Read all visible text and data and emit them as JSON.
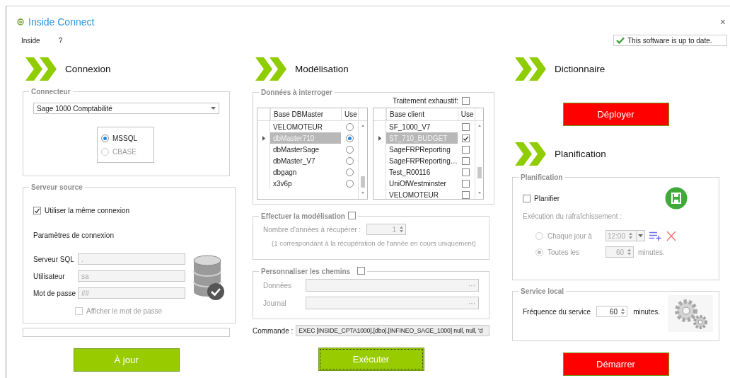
{
  "window": {
    "title": "Inside Connect",
    "close": "×"
  },
  "menu": [
    {
      "label": "Inside"
    },
    {
      "label": "?"
    }
  ],
  "update_status": "This software is up to date.",
  "connexion": {
    "title": "Connexion",
    "connecteur": {
      "legend": "Connecteur",
      "value": "Sage 1000 Comptabilité",
      "options": [
        {
          "label": "MSSQL",
          "selected": true,
          "disabled": false
        },
        {
          "label": "CBASE",
          "selected": false,
          "disabled": true
        }
      ]
    },
    "serveur_source": {
      "legend": "Serveur source",
      "same_connection": {
        "label": "Utiliser la même connexion",
        "checked": true
      },
      "params_label": "Paramètres de connexion",
      "fields": [
        {
          "label": "Serveur SQL",
          "value": "."
        },
        {
          "label": "Utilisateur",
          "value": "sa"
        },
        {
          "label": "Mot de passe",
          "value": "##"
        }
      ],
      "show_password": {
        "label": "Afficher le mot de passe",
        "checked": false
      }
    },
    "button": "À jour"
  },
  "modelisation": {
    "title": "Modélisation",
    "donnees": {
      "legend": "Données à interroger",
      "exhaustive": {
        "label": "Traitement exhaustif:",
        "checked": false
      },
      "tables": [
        {
          "kind": "radio",
          "columns": [
            "Base DBMaster",
            "Use"
          ],
          "rows": [
            {
              "name": "VELOMOTEUR",
              "selected": false,
              "use": false
            },
            {
              "name": "dbMaster710",
              "selected": true,
              "use": true
            },
            {
              "name": "dbMasterSage",
              "selected": false,
              "use": false
            },
            {
              "name": "dbMaster_V7",
              "selected": false,
              "use": false
            },
            {
              "name": "dbgagn",
              "selected": false,
              "use": false
            },
            {
              "name": "x3v6p",
              "selected": false,
              "use": false
            }
          ]
        },
        {
          "kind": "checkbox",
          "columns": [
            "Base client",
            "Use"
          ],
          "rows": [
            {
              "name": "SF_1000_V7",
              "selected": false,
              "use": false
            },
            {
              "name": "ST_710_BUDGET",
              "selected": true,
              "use": true
            },
            {
              "name": "SageFRPReporting",
              "selected": false,
              "use": false
            },
            {
              "name": "SageFRPReporting…",
              "selected": false,
              "use": false
            },
            {
              "name": "Test_R00116",
              "selected": false,
              "use": false
            },
            {
              "name": "UniOfWestminster",
              "selected": false,
              "use": false
            },
            {
              "name": "VELOMOTEUR",
              "selected": false,
              "use": false
            }
          ]
        }
      ]
    },
    "effectuer": {
      "legend": "Effectuer la modélisation",
      "checked": false,
      "years_label": "Nombre d'années à récupérer :",
      "years": "1",
      "note": "(1 correspondant à la récupération de l'année en cours uniquement)"
    },
    "chemins": {
      "legend": "Personnaliser les chemins",
      "checked": false,
      "fields": [
        {
          "label": "Données",
          "browse": "···"
        },
        {
          "label": "Journal",
          "browse": "···"
        }
      ]
    },
    "commande": {
      "label": "Commande :",
      "value": "EXEC [INSIDE_CPTA1000].[dbo].[INFINEO_SAGE_1000] null, null, 'd"
    },
    "button": {
      "label": "Exécuter",
      "focused": true
    }
  },
  "dictionnaire": {
    "title": "Dictionnaire",
    "button": "Déployer"
  },
  "planification": {
    "title": "Planification",
    "legend": "Planification",
    "planifier": {
      "label": "Planifier",
      "checked": false
    },
    "refresh_label": "Exécution du rafraîchissement :",
    "modes": [
      {
        "kind": "time",
        "label": "Chaque jour à",
        "value": "12:00",
        "selected": false
      },
      {
        "kind": "interval",
        "label": "Toutes les",
        "value": "60",
        "unit": "minutes.",
        "selected": true
      }
    ]
  },
  "service_local": {
    "legend": "Service local",
    "label": "Fréquence du service",
    "value": "60",
    "unit": "minutes."
  },
  "demarrer": "Démarrer"
}
